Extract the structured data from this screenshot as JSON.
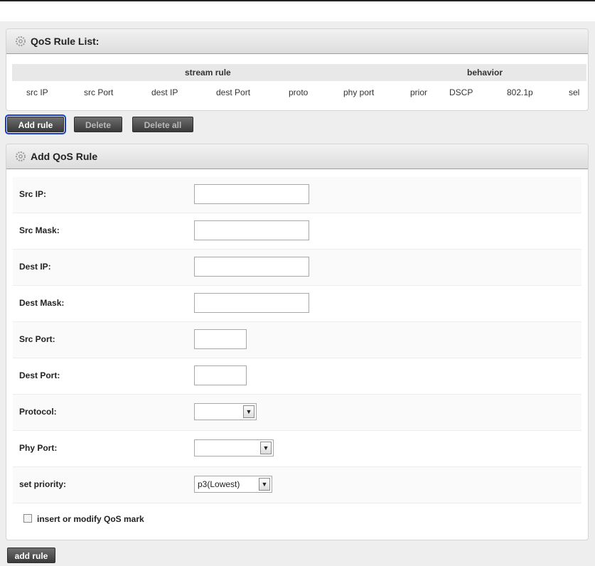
{
  "list_panel": {
    "title": "QoS Rule List:",
    "group_headers": [
      "stream rule",
      "behavior"
    ],
    "columns": [
      "src IP",
      "src Port",
      "dest IP",
      "dest Port",
      "proto",
      "phy port",
      "prior",
      "DSCP",
      "802.1p",
      "sel"
    ]
  },
  "buttons": {
    "add_rule": "Add rule",
    "delete": "Delete",
    "delete_all": "Delete all",
    "submit_add_rule": "add rule"
  },
  "add_panel": {
    "title": "Add QoS Rule",
    "fields": {
      "src_ip": {
        "label": "Src IP:",
        "value": ""
      },
      "src_mask": {
        "label": "Src Mask:",
        "value": ""
      },
      "dest_ip": {
        "label": "Dest IP:",
        "value": ""
      },
      "dest_mask": {
        "label": "Dest Mask:",
        "value": ""
      },
      "src_port": {
        "label": "Src Port:",
        "value": ""
      },
      "dest_port": {
        "label": "Dest Port:",
        "value": ""
      },
      "protocol": {
        "label": "Protocol:",
        "value": ""
      },
      "phy_port": {
        "label": "Phy Port:",
        "value": ""
      },
      "set_priority": {
        "label": "set priority:",
        "value": "p3(Lowest)"
      }
    },
    "qos_mark_checkbox": {
      "label": "insert or modify QoS mark",
      "checked": false
    }
  },
  "icons": {
    "panel_icon": "gear-icon",
    "dropdown_icon": "chevron-down-icon"
  },
  "colors": {
    "header_border": "#c98a8a",
    "button_bg": "#4a4a4a",
    "focus_ring": "#1a3cc9"
  }
}
